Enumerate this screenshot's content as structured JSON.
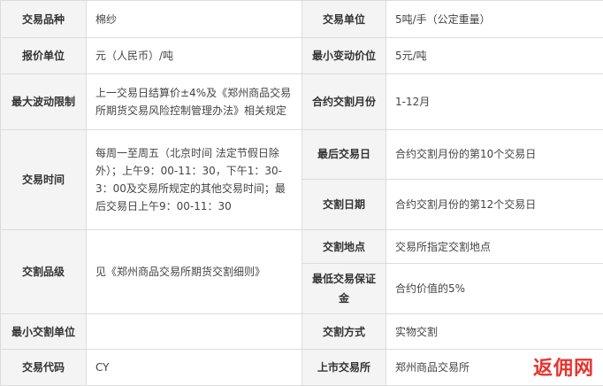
{
  "rows": {
    "variety": {
      "label": "交易品种",
      "value": "棉纱"
    },
    "unit": {
      "label": "交易单位",
      "value": "5吨/手（公定重量）"
    },
    "quote_unit": {
      "label": "报价单位",
      "value": "元（人民币）/吨"
    },
    "tick": {
      "label": "最小变动价位",
      "value": "5元/吨"
    },
    "limit": {
      "label": "最大波动限制",
      "value": "上一交易日结算价±4%及《郑州商品交易所期货交易风险控制管理办法》相关规定"
    },
    "months": {
      "label": "合约交割月份",
      "value": "1-12月"
    },
    "hours": {
      "label": "交易时间",
      "value": "每周一至周五（北京时间 法定节假日除外）；上午9：00-11：30，下午1：30-3：00及交易所规定的其他交易时间；最后交易日上午9：00-11：30"
    },
    "last_day": {
      "label": "最后交易日",
      "value": "合约交割月份的第10个交易日"
    },
    "delivery_date": {
      "label": "交割日期",
      "value": "合约交割月份的第12个交易日"
    },
    "grade": {
      "label": "交割品级",
      "value": "见《郑州商品交易所期货交割细则》"
    },
    "place": {
      "label": "交割地点",
      "value": "交易所指定交割地点"
    },
    "margin": {
      "label": "最低交易保证金",
      "value": "合约价值的5%"
    },
    "min_lot": {
      "label": "最小交割单位",
      "value": ""
    },
    "method": {
      "label": "交割方式",
      "value": "实物交割"
    },
    "code": {
      "label": "交易代码",
      "value": "CY"
    },
    "exchange": {
      "label": "上市交易所",
      "value": "郑州商品交易所"
    }
  },
  "watermark": "返佣网"
}
